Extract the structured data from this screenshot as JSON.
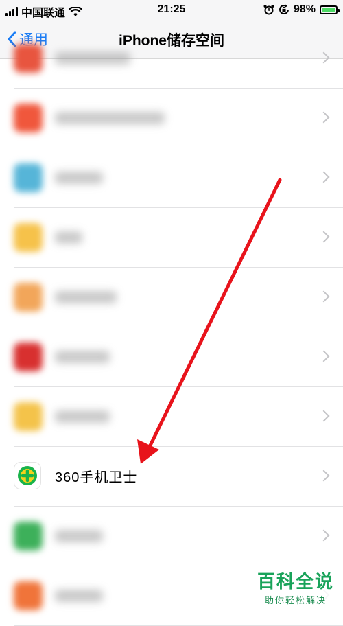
{
  "status_bar": {
    "carrier": "中国联通",
    "time": "21:25",
    "battery_percent_label": "98%",
    "battery_level": 0.98,
    "icons": [
      "signal-icon",
      "wifi-icon",
      "alarm-icon",
      "rotation-lock-icon",
      "battery-charging-icon"
    ]
  },
  "nav": {
    "back_label": "通用",
    "title": "iPhone储存空间"
  },
  "apps": [
    {
      "label": "",
      "icon_color": "#e8553f",
      "blurred": true
    },
    {
      "label": "",
      "icon_color": "#f0573c",
      "blurred": true
    },
    {
      "label": "",
      "icon_color": "#56b5d8",
      "blurred": true
    },
    {
      "label": "",
      "icon_color": "#f6c24a",
      "blurred": true
    },
    {
      "label": "",
      "icon_color": "#f2a65a",
      "blurred": true
    },
    {
      "label": "",
      "icon_color": "#d8302f",
      "blurred": true
    },
    {
      "label": "",
      "icon_color": "#f4c34a",
      "blurred": true
    },
    {
      "label": "360手机卫士",
      "icon_color": "#19b34a",
      "blurred": false
    },
    {
      "label": "",
      "icon_color": "#3db05a",
      "blurred": true
    },
    {
      "label": "",
      "icon_color": "#f0743a",
      "blurred": true
    }
  ],
  "annotation": {
    "arrow_color": "#e8131b"
  },
  "watermark": {
    "title": "百科全说",
    "subtitle": "助你轻松解决"
  }
}
